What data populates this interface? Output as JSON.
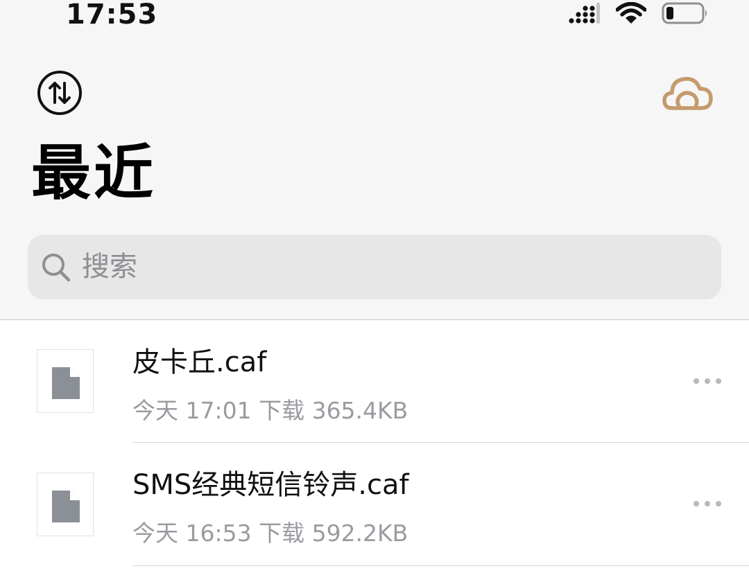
{
  "status_bar": {
    "time": "17:53"
  },
  "header": {
    "title": "最近",
    "sort_icon": "sort-arrows-icon",
    "cloud_icon": "cloud-icon",
    "accent_color": "#c59a6c"
  },
  "search": {
    "placeholder": "搜索"
  },
  "files": [
    {
      "name": "皮卡丘.caf",
      "meta": "今天 17:01 下载 365.4KB"
    },
    {
      "name": "SMS经典短信铃声.caf",
      "meta": "今天 16:53 下载 592.2KB"
    }
  ]
}
